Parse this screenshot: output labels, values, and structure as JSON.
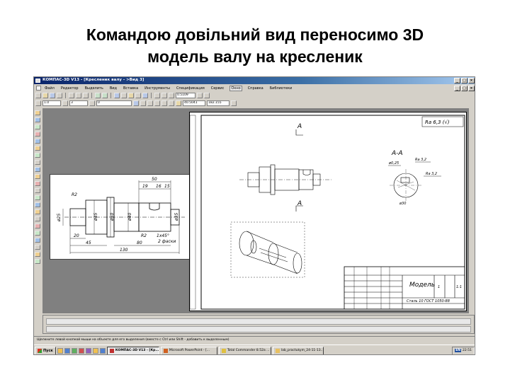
{
  "slide": {
    "title_line1": "Командою довільний вид переносимо 3D",
    "title_line2": "модель валу на кресленик"
  },
  "window": {
    "title": "КОМПАС-3D V13 - [Кресленик валу - >Вид 3]",
    "controls": [
      "_",
      "□",
      "×"
    ]
  },
  "menu": {
    "items": [
      "Файл",
      "Редактор",
      "Выделить",
      "Вид",
      "Вставка",
      "Инструменты",
      "Спецификация",
      "Сервис",
      "Окно",
      "Справка",
      "Библиотеки"
    ],
    "active": "Окно"
  },
  "toolbar": {
    "scale_value": "1.0",
    "layer_value": "3",
    "style_value": "0",
    "x_coord": "40.5041",
    "y_coord": "182.155",
    "zoom_value": "0.5109"
  },
  "drawing": {
    "dims_left": {
      "d25": "ø25",
      "d45": "ø45",
      "d50": "ø50",
      "d40": "ø40",
      "d35": "ø35",
      "r2_top": "R2",
      "r2_bottom": "R2",
      "chamfer": "1x45°",
      "chamfer_count": "2 фаски",
      "l20": "20",
      "l45": "45",
      "l80": "80",
      "l130": "130",
      "l50": "50",
      "l19": "19",
      "l16": "16",
      "l15": "15"
    },
    "section_label_top": "А",
    "section_label_bottom": "А",
    "section_title": "А-А",
    "roughness_general": "Ra 6,3 (√)",
    "roughness_1": "Ra 3,2",
    "roughness_2": "Ra 3,2",
    "section_d30": "ø30",
    "section_d025": "ø0,25",
    "title_block": {
      "name": "Модель",
      "material": "Сталь 10 ГОСТ 1050-88",
      "mass": "1",
      "scale": "1:1"
    }
  },
  "statusbar": {
    "text": "Щелкните левой кнопкой мыши на объекте для его выделения (вместе с Ctrl или Shift - добавить к выделенным)"
  },
  "taskbar": {
    "start": "Пуск",
    "tasks": [
      {
        "label": "КОМПАС-3D V13 - [Кр...",
        "active": true
      },
      {
        "label": "Microsoft PowerPoint - [...",
        "active": false
      },
      {
        "label": "Total Commander 8.52a ...",
        "active": false
      },
      {
        "label": "lab_practukym_24-11-13...",
        "active": false
      }
    ],
    "lang": "EN",
    "clock": "22:51"
  },
  "colors": {
    "titlebar": "#0a246a",
    "window_bg": "#d4d0c8",
    "workspace": "#808080",
    "sheet": "#ffffff",
    "drawing_line": "#000000"
  }
}
